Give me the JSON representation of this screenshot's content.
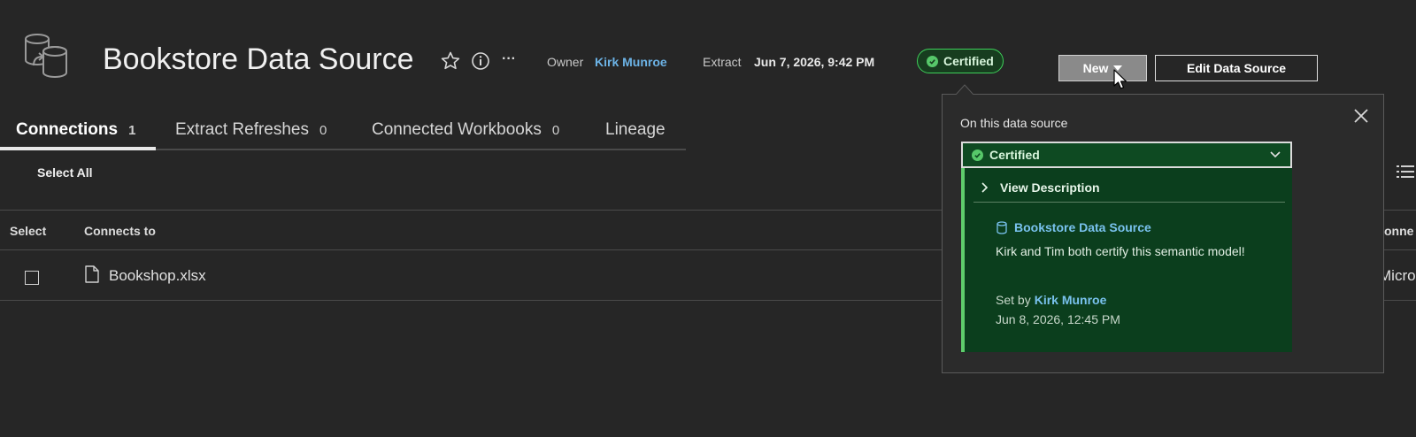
{
  "header": {
    "title": "Bookstore Data Source",
    "owner_label": "Owner",
    "owner_name": "Kirk Munroe",
    "extract_label": "Extract",
    "extract_value": "Jun 7, 2026, 9:42 PM",
    "certified_label": "Certified",
    "new_label": "New",
    "edit_label": "Edit Data Source",
    "more_glyph": "···"
  },
  "tabs": [
    {
      "label": "Connections",
      "count": "1",
      "active": true
    },
    {
      "label": "Extract Refreshes",
      "count": "0",
      "active": false
    },
    {
      "label": "Connected Workbooks",
      "count": "0",
      "active": false
    },
    {
      "label": "Lineage",
      "count": "",
      "active": false
    }
  ],
  "toolbar": {
    "select_all": "Select All"
  },
  "table": {
    "columns": [
      "Select",
      "Connects to",
      "onne"
    ],
    "rows": [
      {
        "file": "Bookshop.xlsx",
        "right_value": "Microso"
      }
    ]
  },
  "popover": {
    "heading": "On this data source",
    "selected": "Certified",
    "view_description": "View Description",
    "datasource_name": "Bookstore Data Source",
    "description": "Kirk and Tim both certify this semantic model!",
    "set_by_label": "Set by",
    "set_by_name": "Kirk Munroe",
    "set_date": "Jun 8, 2026, 12:45 PM"
  },
  "colors": {
    "background": "#262626",
    "certified_green": "#3ecf5a",
    "panel_green": "#0b3e1d",
    "link_blue": "#6cb3e6"
  },
  "icons": [
    "datasource-icon",
    "star-icon",
    "info-icon",
    "more-icon",
    "check-circle-icon",
    "dropdown-arrow-icon",
    "cursor-icon",
    "close-icon",
    "chevron-down-icon",
    "chevron-right-icon",
    "database-icon",
    "file-icon",
    "list-view-icon"
  ]
}
